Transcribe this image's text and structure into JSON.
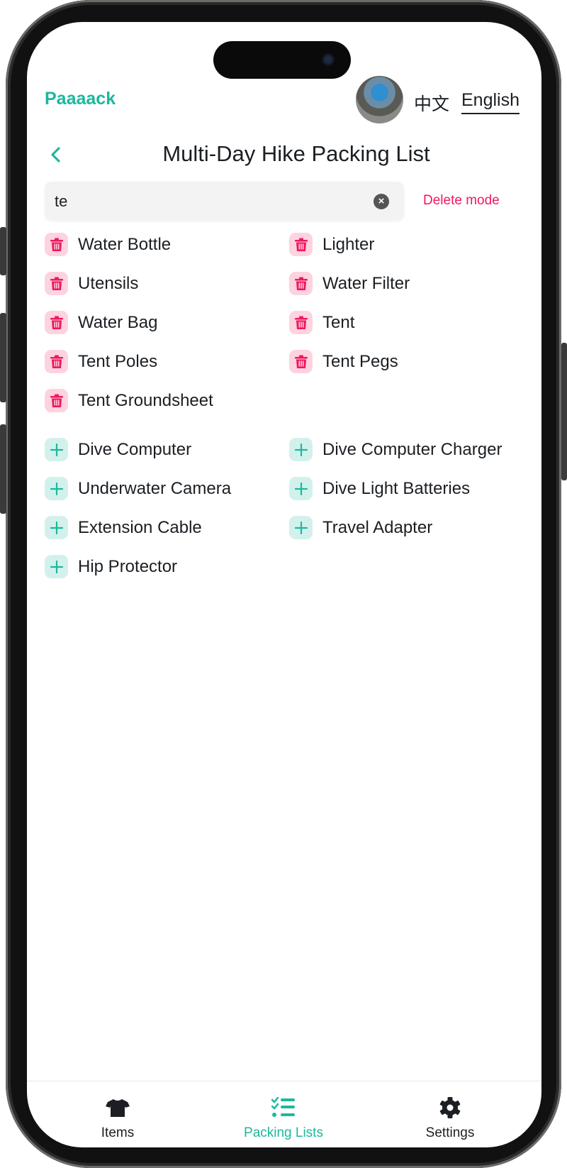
{
  "header": {
    "brand": "Paaaack",
    "lang_zh": "中文",
    "lang_en": "English"
  },
  "page": {
    "title": "Multi-Day Hike Packing List"
  },
  "search": {
    "value": "te",
    "delete_mode_label": "Delete mode"
  },
  "list_items": [
    "Water Bottle",
    "Lighter",
    "Utensils",
    "Water Filter",
    "Water Bag",
    "Tent",
    "Tent Poles",
    "Tent Pegs",
    "Tent Groundsheet"
  ],
  "suggested_items": [
    "Dive Computer",
    "Dive Computer Charger",
    "Underwater Camera",
    "Dive Light Batteries",
    "Extension Cable",
    "Travel Adapter",
    "Hip Protector"
  ],
  "tabs": [
    {
      "label": "Items",
      "icon": "shirt-icon"
    },
    {
      "label": "Packing Lists",
      "icon": "checklist-icon",
      "active": true
    },
    {
      "label": "Settings",
      "icon": "gear-icon"
    }
  ],
  "colors": {
    "accent": "#1cb89e",
    "danger": "#f0185e"
  }
}
